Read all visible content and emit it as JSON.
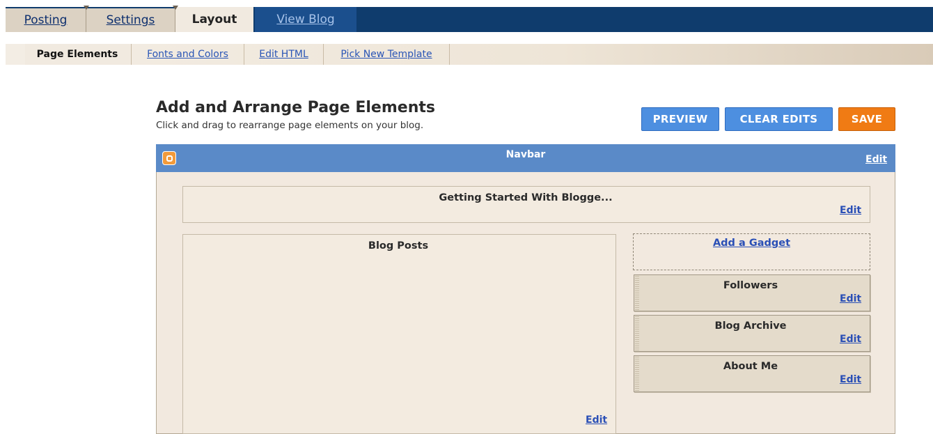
{
  "main_tabs": [
    {
      "label": "Posting"
    },
    {
      "label": "Settings"
    },
    {
      "label": "Layout"
    },
    {
      "label": "View Blog"
    }
  ],
  "sub_tabs": [
    {
      "label": "Page Elements"
    },
    {
      "label": "Fonts and Colors"
    },
    {
      "label": "Edit HTML"
    },
    {
      "label": "Pick New Template"
    }
  ],
  "header": {
    "title": "Add and Arrange Page Elements",
    "subtitle": "Click and drag to rearrange page elements on your blog."
  },
  "buttons": {
    "preview": "PREVIEW",
    "clear_edits": "CLEAR EDITS",
    "save": "SAVE"
  },
  "navbar": {
    "title": "Navbar",
    "edit": "Edit"
  },
  "header_gadget": {
    "title": "Getting Started With Blogge...",
    "edit": "Edit"
  },
  "blog_posts": {
    "title": "Blog Posts",
    "edit": "Edit"
  },
  "sidebar": {
    "add_gadget": "Add a Gadget",
    "gadgets": [
      {
        "title": "Followers",
        "edit": "Edit"
      },
      {
        "title": "Blog Archive",
        "edit": "Edit"
      },
      {
        "title": "About Me",
        "edit": "Edit"
      }
    ]
  },
  "colors": {
    "top_bar": "#0f3c6d",
    "navbar": "#5a8ac8",
    "canvas": "#f2e9df",
    "link": "#2a4fb6",
    "button_blue": "#4d8fe0",
    "button_orange": "#f07b14"
  },
  "icons": {
    "navbar_logo": "blogger-logo-icon"
  }
}
